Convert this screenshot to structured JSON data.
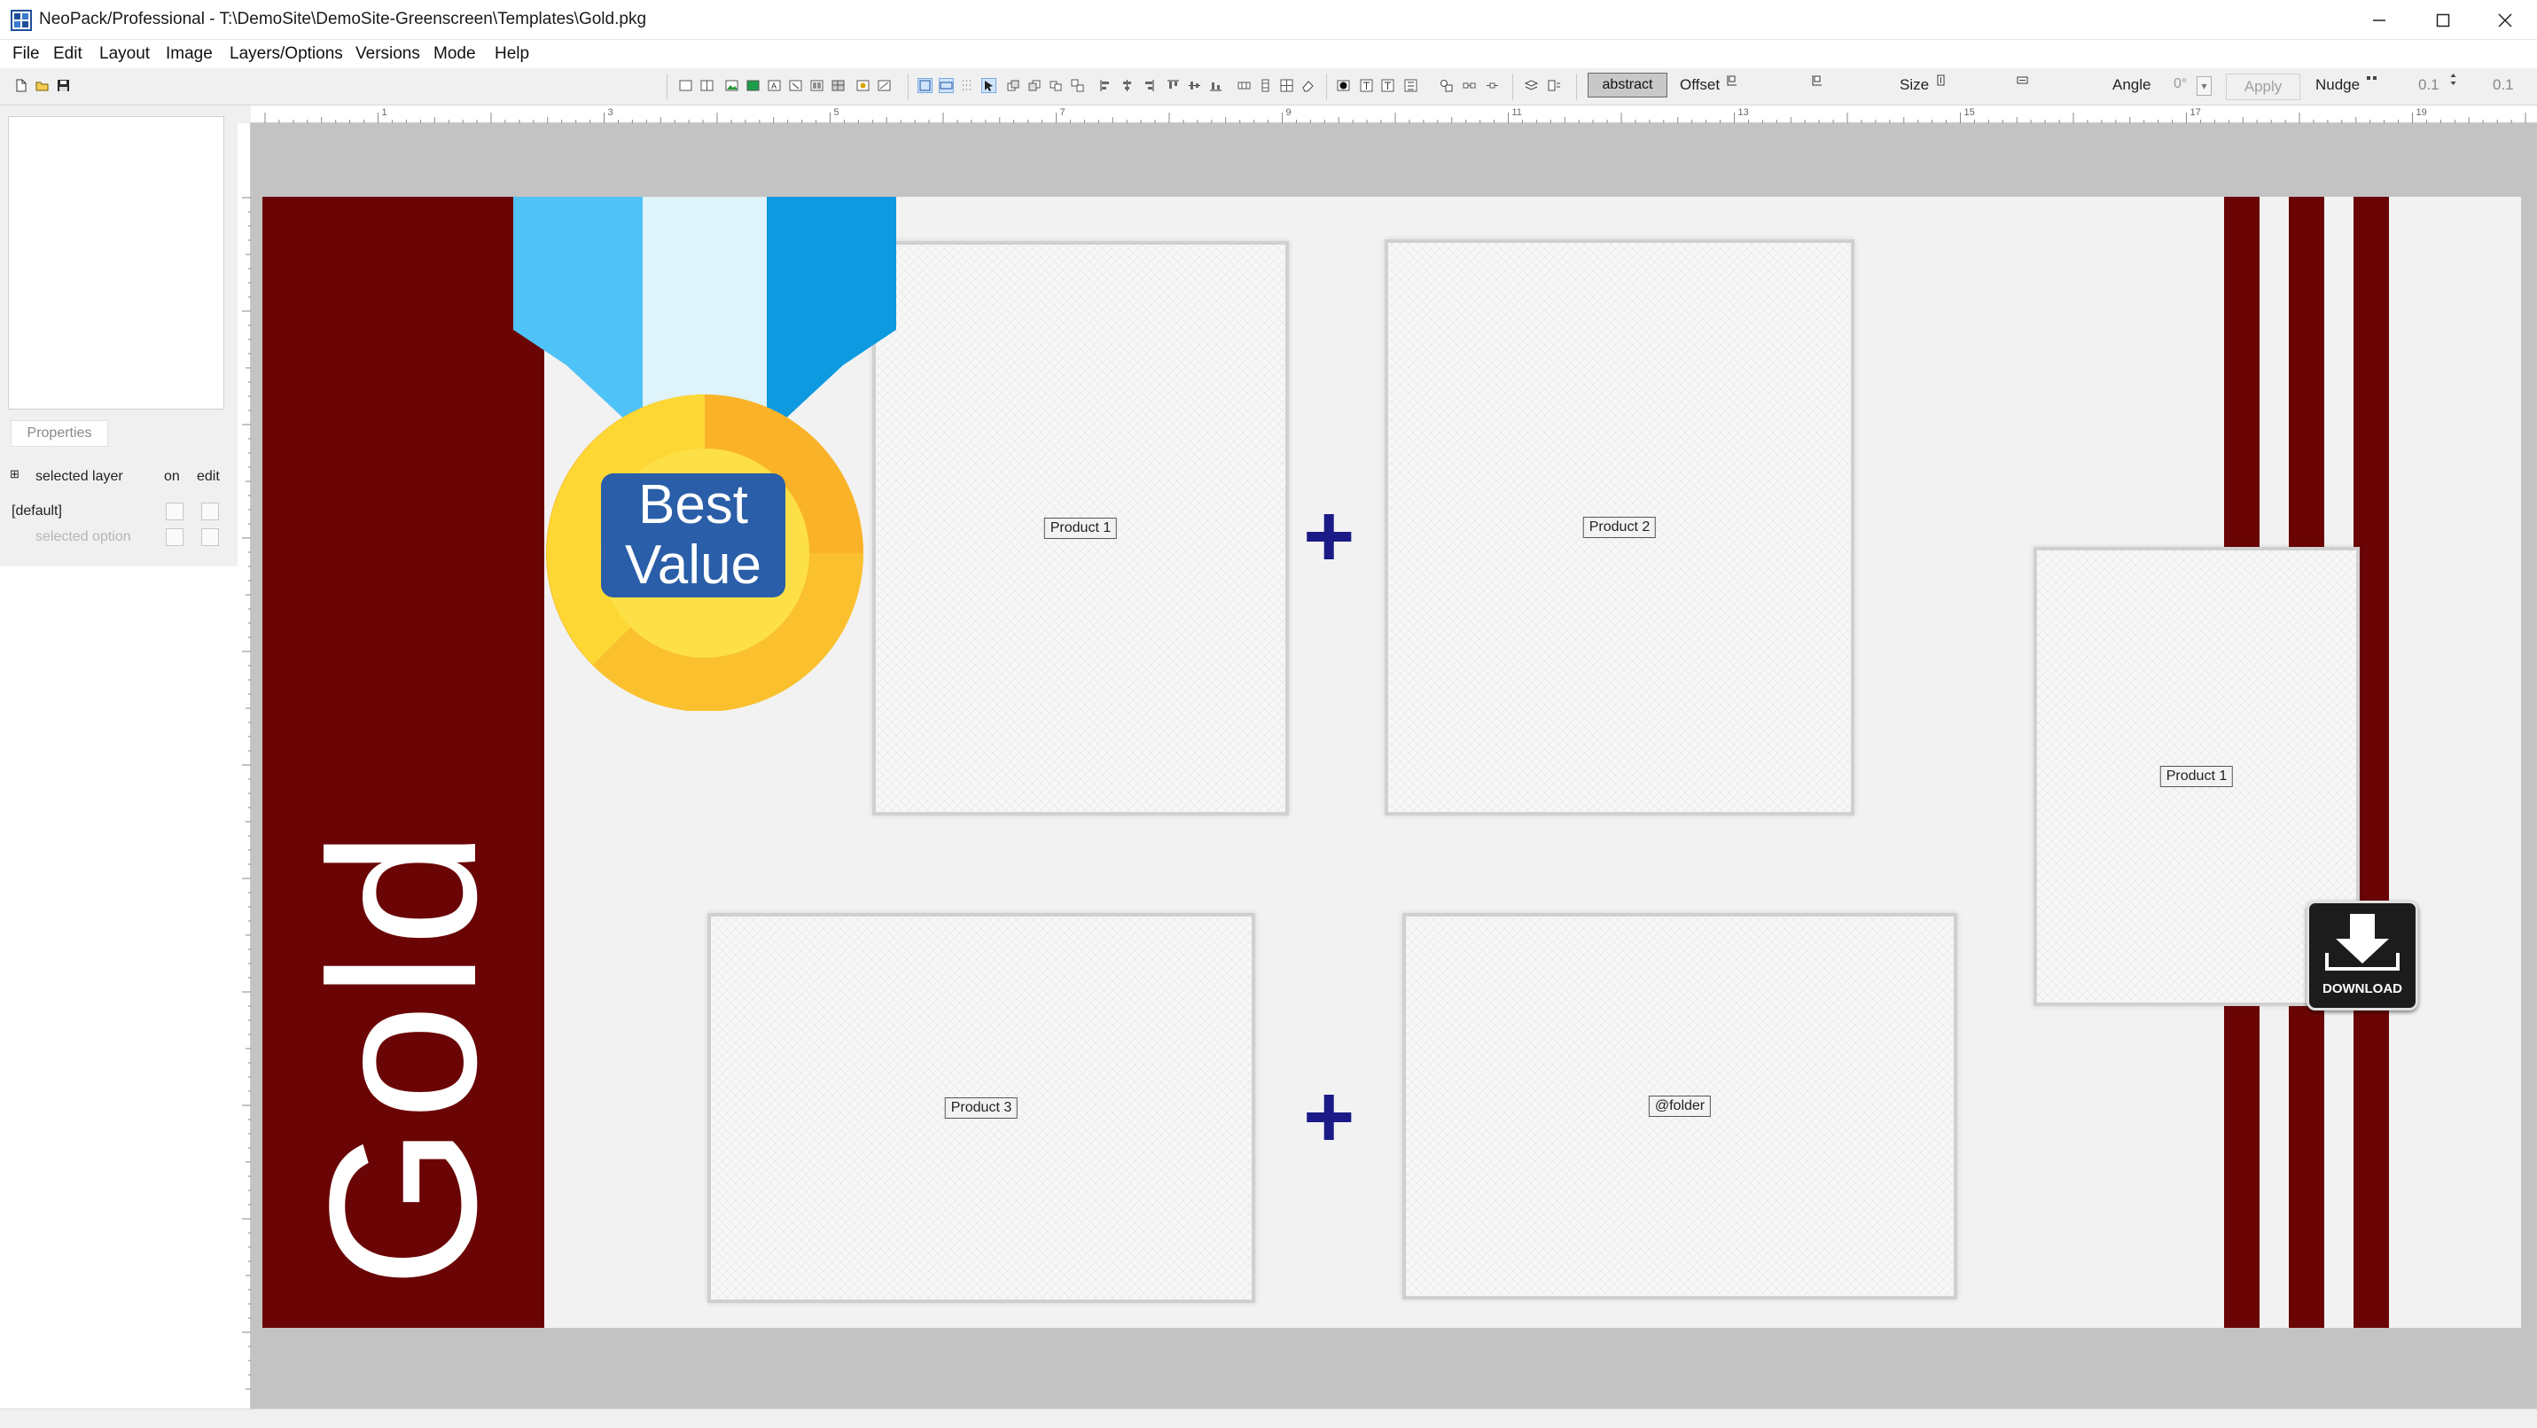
{
  "window": {
    "title": "NeoPack/Professional - T:\\DemoSite\\DemoSite-Greenscreen\\Templates\\Gold.pkg",
    "controls": [
      "minimize-icon",
      "maximize-icon",
      "close-icon"
    ]
  },
  "menu": {
    "items": [
      "File",
      "Edit",
      "Layout",
      "Image",
      "Layers/Options",
      "Versions",
      "Mode",
      "Help"
    ]
  },
  "toolbar": {
    "abstract_label": "abstract",
    "offset_label": "Offset",
    "size_label": "Size",
    "angle_label": "Angle",
    "angle_value": "0°",
    "apply_label": "Apply",
    "nudge_label": "Nudge",
    "nudge_value_1": "0.1",
    "nudge_value_2": "0.1"
  },
  "sidebar": {
    "properties_tab": "Properties",
    "layer_header": {
      "expander": "⊞",
      "selected_layer": "selected layer",
      "on": "on",
      "edit": "edit"
    },
    "rows": [
      {
        "label": "[default]"
      },
      {
        "label": "selected option"
      }
    ]
  },
  "ruler": {
    "labels": [
      "1",
      "3",
      "5",
      "7",
      "9",
      "11",
      "13",
      "15",
      "17",
      "19"
    ]
  },
  "canvas": {
    "band_text": "Gold",
    "band_color": "#6b0505",
    "medal_text_line1": "Best",
    "medal_text_line2": "Value",
    "placeholders": {
      "p1": "Product 1",
      "p2": "Product 2",
      "p3": "Product 3",
      "p4": "@folder",
      "p5": "Product 1"
    },
    "plus_symbol": "+",
    "download_label": "DOWNLOAD"
  }
}
